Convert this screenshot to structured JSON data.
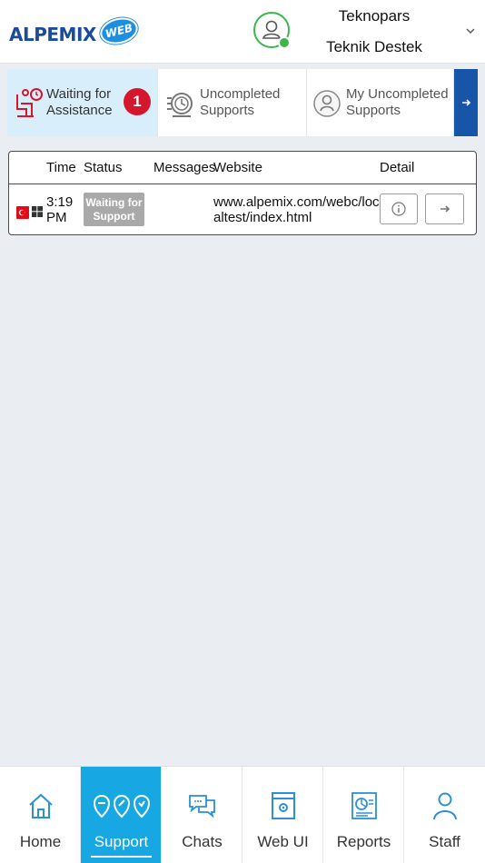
{
  "header": {
    "logo_text": "ALPEMIX",
    "logo_badge": "WEB",
    "user_name": "Teknopars",
    "user_group": "Teknik Destek",
    "online_color": "#3cb64a"
  },
  "tabs": [
    {
      "label": "Waiting for Assistance",
      "badge": "1",
      "icon": "waiting-chair-icon",
      "active": true
    },
    {
      "label": "Uncompleted Supports",
      "icon": "clock-gear-icon",
      "active": false
    },
    {
      "label": "My Uncompleted Supports",
      "icon": "user-circle-icon",
      "active": false
    }
  ],
  "table": {
    "headers": {
      "time": "Time",
      "status": "Status",
      "messages": "Messages",
      "website": "Website",
      "detail": "Detail"
    },
    "rows": [
      {
        "country_flag": "turkey-flag-icon",
        "os": "windows-icon",
        "time": "3:19 PM",
        "status": "Waiting for Support",
        "messages": "",
        "website": "www.alpemix.com/webc/localtest/index.html"
      }
    ]
  },
  "bottom_nav": [
    {
      "label": "Home",
      "icon": "home-icon"
    },
    {
      "label": "Support",
      "icon": "support-pins-icon",
      "active": true
    },
    {
      "label": "Chats",
      "icon": "chat-bubbles-icon"
    },
    {
      "label": "Web UI",
      "icon": "web-window-icon"
    },
    {
      "label": "Reports",
      "icon": "report-chart-icon"
    },
    {
      "label": "Staff",
      "icon": "person-icon"
    }
  ],
  "colors": {
    "brand_blue": "#1a4b9c",
    "accent_cyan": "#17a8e3",
    "active_tab_bg": "#d8eefb",
    "badge_red": "#d5172e",
    "tabs_next_bg": "#1655a8",
    "status_gray": "#a9a9a9"
  }
}
